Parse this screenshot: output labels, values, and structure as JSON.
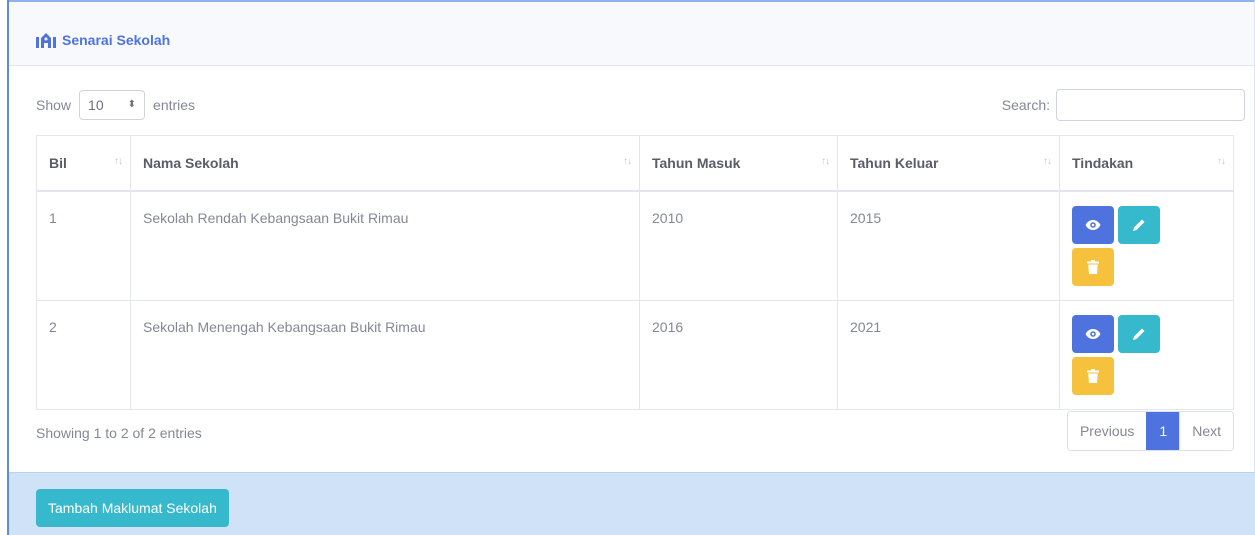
{
  "header": {
    "title": "Senarai Sekolah",
    "icon": "school-icon"
  },
  "controls": {
    "show_label": "Show",
    "page_size": "10",
    "entries_label": "entries",
    "search_label": "Search:",
    "search_value": ""
  },
  "table": {
    "columns": [
      "Bil",
      "Nama Sekolah",
      "Tahun Masuk",
      "Tahun Keluar",
      "Tindakan"
    ],
    "rows": [
      {
        "bil": "1",
        "nama": "Sekolah Rendah Kebangsaan Bukit Rimau",
        "masuk": "2010",
        "keluar": "2015"
      },
      {
        "bil": "2",
        "nama": "Sekolah Menengah Kebangsaan Bukit Rimau",
        "masuk": "2016",
        "keluar": "2021"
      }
    ],
    "action_icons": [
      "eye-icon",
      "pencil-icon",
      "trash-icon"
    ]
  },
  "footer": {
    "info": "Showing 1 to 2 of 2 entries",
    "previous": "Previous",
    "page": "1",
    "next": "Next"
  },
  "actions": {
    "add_label": "Tambah Maklumat Sekolah"
  },
  "colors": {
    "primary": "#4e73df",
    "info": "#36b9cc",
    "warning": "#f6c23e",
    "band": "#cfe2f7"
  }
}
